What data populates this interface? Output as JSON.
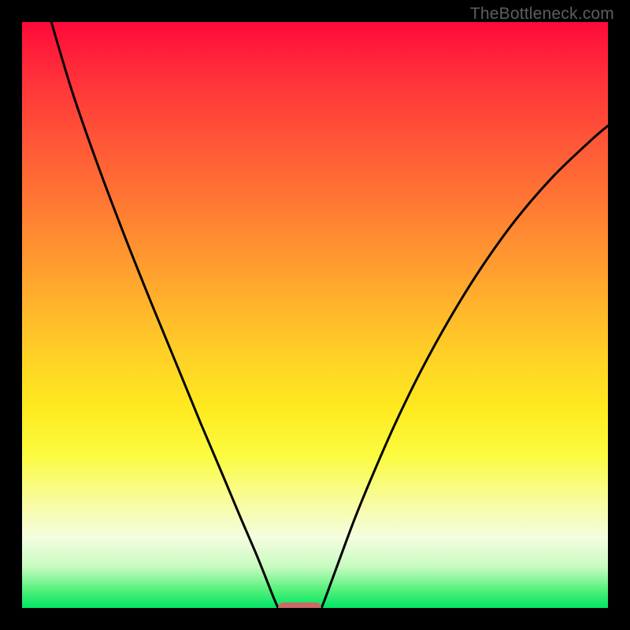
{
  "watermark": "TheBottleneck.com",
  "colors": {
    "frame": "#000000",
    "curve": "#000000",
    "marker": "#cc6a66",
    "watermark_text": "#5e5e5e"
  },
  "chart_data": {
    "type": "line",
    "title": "",
    "xlabel": "",
    "ylabel": "",
    "xlim": [
      0,
      100
    ],
    "ylim": [
      0,
      100
    ],
    "grid": false,
    "series": [
      {
        "name": "left-curve",
        "x": [
          5.0,
          8.6,
          13.0,
          17.5,
          22.0,
          26.4,
          30.5,
          34.2,
          37.3,
          39.8,
          41.5,
          42.6,
          43.3,
          43.7
        ],
        "y": [
          100.0,
          88.0,
          75.4,
          63.5,
          52.2,
          41.5,
          31.5,
          22.8,
          15.4,
          9.6,
          5.4,
          2.6,
          0.9,
          0.0
        ]
      },
      {
        "name": "right-curve",
        "x": [
          51.1,
          51.7,
          52.8,
          54.6,
          57.0,
          60.1,
          63.8,
          68.1,
          73.0,
          78.4,
          84.3,
          90.6,
          97.3,
          100.0
        ],
        "y": [
          0.0,
          1.5,
          4.5,
          9.4,
          15.8,
          23.3,
          31.7,
          40.5,
          49.4,
          58.1,
          66.3,
          73.6,
          80.0,
          82.3
        ]
      }
    ],
    "marker": {
      "x_start": 43.7,
      "x_end": 51.1,
      "y": 0.0
    }
  }
}
